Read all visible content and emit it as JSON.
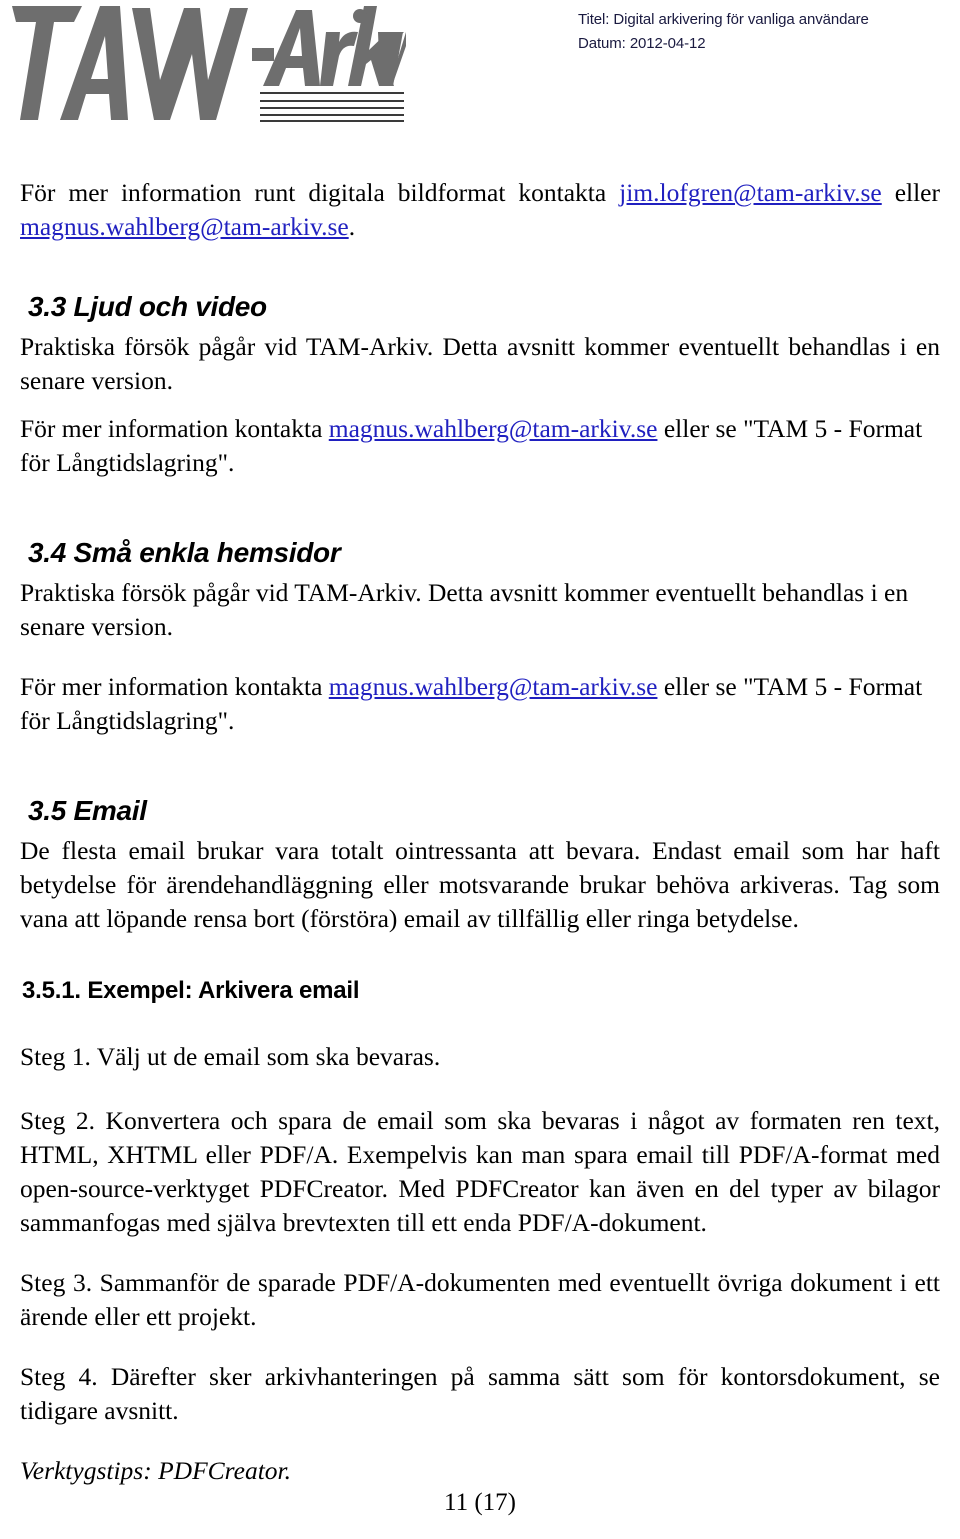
{
  "header": {
    "logo_alt": "TAM-Arkiv",
    "title_line": "Titel: Digital arkivering för vanliga användare",
    "date_line": "Datum: 2012-04-12",
    "meta_color": "#1a1a40"
  },
  "colors": {
    "text": "#000000",
    "link": "#2020c0",
    "logo_gray": "#6e6e6e",
    "page_background": "#ffffff"
  },
  "intro": {
    "before_link": "För mer information runt digitala bildformat kontakta ",
    "link1": "jim.lofgren@tam-arkiv.se",
    "between": " eller ",
    "link2": "magnus.wahlberg@tam-arkiv.se",
    "after": "."
  },
  "sections": [
    {
      "heading": "3.3 Ljud och video",
      "paragraph": "Praktiska försök pågår vid TAM-Arkiv. Detta avsnitt kommer eventuellt behandlas i en senare version.",
      "contact_before": "För mer information kontakta ",
      "contact_link": "magnus.wahlberg@tam-arkiv.se",
      "contact_after": " eller se \"TAM 5 - Format för Långtidslagring\"."
    },
    {
      "heading": "3.4 Små enkla hemsidor",
      "paragraph": "Praktiska försök pågår vid TAM-Arkiv. Detta avsnitt kommer eventuellt behandlas i en senare version.",
      "contact_before": "För mer information kontakta ",
      "contact_link": "magnus.wahlberg@tam-arkiv.se",
      "contact_after": " eller se \"TAM 5 - Format för Långtidslagring\"."
    }
  ],
  "email_section": {
    "heading": "3.5 Email",
    "paragraph": "De flesta email brukar vara totalt ointressanta att bevara. Endast email som har haft betydelse för ärendehandläggning eller motsvarande brukar behöva arkiveras. Tag som vana att löpande rensa bort (förstöra) email av tillfällig eller ringa betydelse.",
    "subheading": "3.5.1. Exempel: Arkivera email",
    "steps": [
      "Steg 1. Välj ut de email som ska bevaras.",
      "Steg 2. Konvertera och spara de email som ska bevaras i något av formaten ren text, HTML, XHTML eller PDF/A. Exempelvis kan man spara email  till PDF/A-format med open-source-verktyget PDFCreator. Med PDFCreator kan även en del typer av bilagor sammanfogas med själva brevtexten till ett enda PDF/A-dokument.",
      "Steg 3. Sammanför de sparade PDF/A-dokumenten med eventuellt övriga dokument i ett ärende eller ett projekt.",
      "Steg 4. Därefter sker arkivhanteringen på samma sätt som för kontorsdokument, se tidigare avsnitt."
    ],
    "tip": "Verktygstips: PDFCreator."
  },
  "footer": {
    "page_number": "11 (17)"
  }
}
